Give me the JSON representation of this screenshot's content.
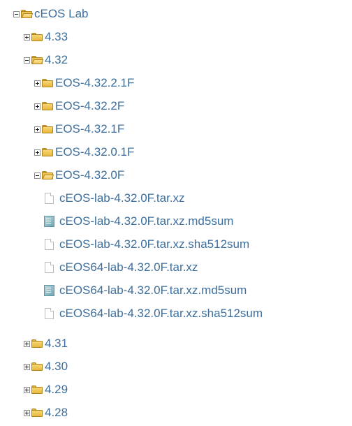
{
  "tree": {
    "root": {
      "label": "cEOS Lab",
      "expanded": true
    },
    "versions": [
      {
        "label": "4.33",
        "expanded": false
      },
      {
        "label": "4.32",
        "expanded": true
      },
      {
        "label": "4.31",
        "expanded": false
      },
      {
        "label": "4.30",
        "expanded": false
      },
      {
        "label": "4.29",
        "expanded": false
      },
      {
        "label": "4.28",
        "expanded": false
      }
    ],
    "releases_4_32": [
      {
        "label": "EOS-4.32.2.1F",
        "expanded": false
      },
      {
        "label": "EOS-4.32.2F",
        "expanded": false
      },
      {
        "label": "EOS-4.32.1F",
        "expanded": false
      },
      {
        "label": "EOS-4.32.0.1F",
        "expanded": false
      },
      {
        "label": "EOS-4.32.0F",
        "expanded": true
      }
    ],
    "files_eos_4_32_0F": [
      {
        "label": "cEOS-lab-4.32.0F.tar.xz",
        "icon": "file-icon"
      },
      {
        "label": "cEOS-lab-4.32.0F.tar.xz.md5sum",
        "icon": "checksum-file-icon"
      },
      {
        "label": "cEOS-lab-4.32.0F.tar.xz.sha512sum",
        "icon": "file-icon"
      },
      {
        "label": "cEOS64-lab-4.32.0F.tar.xz",
        "icon": "file-icon"
      },
      {
        "label": "cEOS64-lab-4.32.0F.tar.xz.md5sum",
        "icon": "checksum-file-icon"
      },
      {
        "label": "cEOS64-lab-4.32.0F.tar.xz.sha512sum",
        "icon": "file-icon"
      }
    ]
  },
  "colors": {
    "link": "#3d6f9e",
    "folder": "#e8b73c",
    "checksum_icon": "#6ea7b3"
  }
}
